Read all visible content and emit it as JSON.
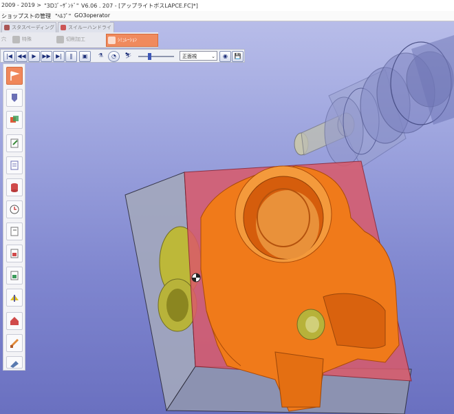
{
  "window": {
    "title_left": "2009 - 2019 >",
    "title_app": "\"3Dｺﾞｰｻﾞﾝﾄﾞ\"",
    "title_version": "V6.06 . 207 - [アップライトボスLAPCE.FC]*]"
  },
  "menubar": {
    "items": [
      "ショップストの管理",
      "\"ﾍﾙﾌﾟ\"",
      "GO3operator"
    ]
  },
  "tabs": [
    {
      "label": "スタスペーディング"
    },
    {
      "label": "スイルーハンドライ"
    }
  ],
  "function_buttons": [
    {
      "label": "穴"
    },
    {
      "label": "特殊"
    },
    {
      "label": "切削加工"
    },
    {
      "label": "ｼﾐｭﾚｰｼｮﾝ"
    }
  ],
  "playback": {
    "view_select": "正面視",
    "buttons": [
      "first-frame",
      "rewind",
      "play",
      "fast-forward",
      "last-frame",
      "step",
      "snapshot",
      "record",
      "probe",
      "reset"
    ]
  },
  "sidebar": {
    "tools": [
      "flag-tool",
      "cutter-tool",
      "paint-tool",
      "doc-edit-tool",
      "doc-tool",
      "stack-tool",
      "clock-tool",
      "page-tool",
      "doc-red-tool",
      "doc-green-tool",
      "arrow-tool",
      "home-tool",
      "brush-tool",
      "wrench-tool"
    ]
  },
  "colors": {
    "viewport_top": "#b8bde9",
    "viewport_bottom": "#6a70c0",
    "part_orange": "#f07a1a",
    "stock_red": "#d9536b",
    "stock_gray": "#9aa1b8",
    "accent": "#f08a5d"
  }
}
